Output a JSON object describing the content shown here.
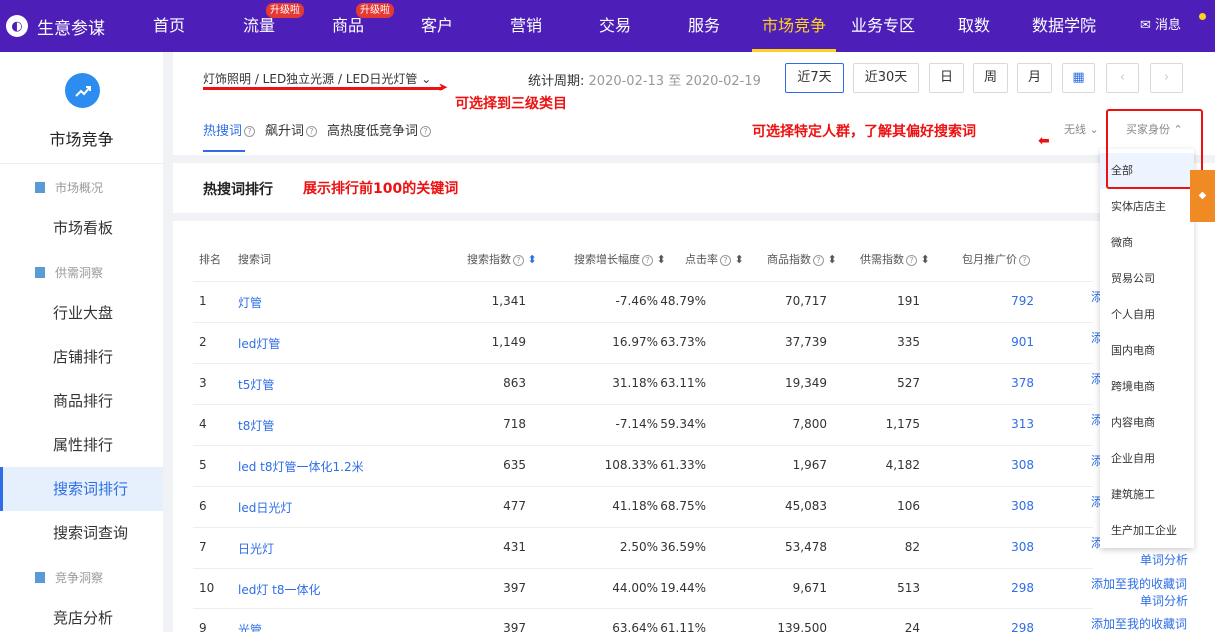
{
  "app": {
    "name": "生意参谋",
    "logo_icon": "compass-icon"
  },
  "nav": {
    "items": [
      {
        "label": "首页",
        "badge": "",
        "active": false
      },
      {
        "label": "流量",
        "badge": "升级啦",
        "active": false
      },
      {
        "label": "商品",
        "badge": "升级啦",
        "active": false
      },
      {
        "label": "客户",
        "badge": "",
        "active": false
      },
      {
        "label": "营销",
        "badge": "",
        "active": false
      },
      {
        "label": "交易",
        "badge": "",
        "active": false
      },
      {
        "label": "服务",
        "badge": "",
        "active": false
      },
      {
        "label": "市场竞争",
        "badge": "",
        "active": true
      },
      {
        "label": "业务专区",
        "badge": "",
        "active": false
      },
      {
        "label": "取数",
        "badge": "",
        "active": false
      },
      {
        "label": "数据学院",
        "badge": "",
        "active": false
      }
    ],
    "message": "消息"
  },
  "sidebar": {
    "title": "市场竞争",
    "groups": [
      {
        "label": "市场概况",
        "items": [
          {
            "label": "市场看板",
            "active": false
          }
        ]
      },
      {
        "label": "供需洞察",
        "items": [
          {
            "label": "行业大盘",
            "active": false
          },
          {
            "label": "店铺排行",
            "active": false
          },
          {
            "label": "商品排行",
            "active": false
          },
          {
            "label": "属性排行",
            "active": false
          },
          {
            "label": "搜索词排行",
            "active": true
          },
          {
            "label": "搜索词查询",
            "active": false
          }
        ]
      },
      {
        "label": "竞争洞察",
        "items": [
          {
            "label": "竞店分析",
            "active": false
          }
        ]
      }
    ]
  },
  "header": {
    "category": "灯饰照明 / LED独立光源 / LED日光灯管",
    "period_label": "统计周期:",
    "period_value": "2020-02-13 至 2020-02-19",
    "buttons": {
      "d7": "近7天",
      "d30": "近30天",
      "day": "日",
      "week": "周",
      "month": "月"
    }
  },
  "annotations": {
    "category": "可选择到三级类目",
    "crowd": "可选择特定人群，了解其偏好搜索词",
    "ranking": "展示排行前100的关键词"
  },
  "tabs": [
    {
      "label": "热搜词",
      "active": true
    },
    {
      "label": "飙升词",
      "active": false
    },
    {
      "label": "高热度低竞争词",
      "active": false
    }
  ],
  "filters": {
    "device": "无线",
    "buyer": "买家身份"
  },
  "section_title": "热搜词排行",
  "table": {
    "headers": [
      "排名",
      "搜索词",
      "搜索指数",
      "搜索增长幅度",
      "点击率",
      "商品指数",
      "供需指数",
      "包月推广价"
    ],
    "rows": [
      {
        "rank": "1",
        "keyword": "灯管",
        "search": "1,341",
        "growth": "-7.46%",
        "ctr": "48.79%",
        "goods": "70,717",
        "supply": "191",
        "price": "792"
      },
      {
        "rank": "2",
        "keyword": "led灯管",
        "search": "1,149",
        "growth": "16.97%",
        "ctr": "63.73%",
        "goods": "37,739",
        "supply": "335",
        "price": "901"
      },
      {
        "rank": "3",
        "keyword": "t5灯管",
        "search": "863",
        "growth": "31.18%",
        "ctr": "63.11%",
        "goods": "19,349",
        "supply": "527",
        "price": "378"
      },
      {
        "rank": "4",
        "keyword": "t8灯管",
        "search": "718",
        "growth": "-7.14%",
        "ctr": "59.34%",
        "goods": "7,800",
        "supply": "1,175",
        "price": "313"
      },
      {
        "rank": "5",
        "keyword": "led t8灯管一体化1.2米",
        "search": "635",
        "growth": "108.33%",
        "ctr": "61.33%",
        "goods": "1,967",
        "supply": "4,182",
        "price": "308"
      },
      {
        "rank": "6",
        "keyword": "led日光灯",
        "search": "477",
        "growth": "41.18%",
        "ctr": "68.75%",
        "goods": "45,083",
        "supply": "106",
        "price": "308"
      },
      {
        "rank": "7",
        "keyword": "日光灯",
        "search": "431",
        "growth": "2.50%",
        "ctr": "36.59%",
        "goods": "53,478",
        "supply": "82",
        "price": "308"
      },
      {
        "rank": "10",
        "keyword": "led灯 t8一体化",
        "search": "397",
        "growth": "44.00%",
        "ctr": "19.44%",
        "goods": "9,671",
        "supply": "513",
        "price": "298"
      },
      {
        "rank": "9",
        "keyword": "光管",
        "search": "397",
        "growth": "63.64%",
        "ctr": "61.11%",
        "goods": "139,500",
        "supply": "24",
        "price": "298"
      }
    ],
    "actions": {
      "add": "添加至我的收藏词",
      "analyze": "单词分析",
      "add_short": "添"
    }
  },
  "buyer_dropdown": {
    "items": [
      "全部",
      "实体店店主",
      "微商",
      "贸易公司",
      "个人自用",
      "国内电商",
      "跨境电商",
      "内容电商",
      "企业自用",
      "建筑施工",
      "生产加工企业"
    ],
    "selected": "全部"
  },
  "colors": {
    "nav_bg": "#4d1fb8",
    "active_yellow": "#ffd21e",
    "accent_blue": "#2d6ee6",
    "annotation_red": "#e11"
  }
}
